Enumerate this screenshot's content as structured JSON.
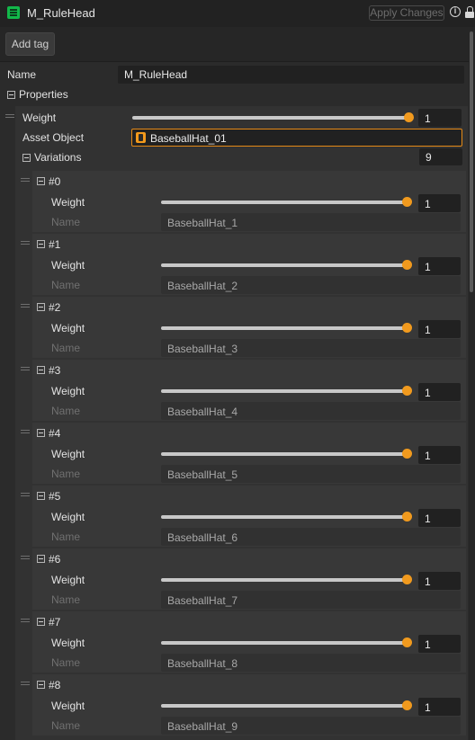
{
  "window": {
    "title": "M_RuleHead",
    "apply_label": "Apply Changes"
  },
  "toolbar": {
    "add_tag_label": "Add tag"
  },
  "name_row": {
    "label": "Name",
    "value": "M_RuleHead"
  },
  "properties": {
    "label": "Properties",
    "weight_label": "Weight",
    "weight_value": "1",
    "weight_fraction": 1.0,
    "asset_label": "Asset Object",
    "asset_value": "BaseballHat_01",
    "variations_label": "Variations",
    "variations_count": "9",
    "variations": [
      {
        "header": "#0",
        "weight_label": "Weight",
        "weight": "1",
        "weight_fraction": 1.0,
        "name_label": "Name",
        "name": "BaseballHat_1"
      },
      {
        "header": "#1",
        "weight_label": "Weight",
        "weight": "1",
        "weight_fraction": 1.0,
        "name_label": "Name",
        "name": "BaseballHat_2"
      },
      {
        "header": "#2",
        "weight_label": "Weight",
        "weight": "1",
        "weight_fraction": 1.0,
        "name_label": "Name",
        "name": "BaseballHat_3"
      },
      {
        "header": "#3",
        "weight_label": "Weight",
        "weight": "1",
        "weight_fraction": 1.0,
        "name_label": "Name",
        "name": "BaseballHat_4"
      },
      {
        "header": "#4",
        "weight_label": "Weight",
        "weight": "1",
        "weight_fraction": 1.0,
        "name_label": "Name",
        "name": "BaseballHat_5"
      },
      {
        "header": "#5",
        "weight_label": "Weight",
        "weight": "1",
        "weight_fraction": 1.0,
        "name_label": "Name",
        "name": "BaseballHat_6"
      },
      {
        "header": "#6",
        "weight_label": "Weight",
        "weight": "1",
        "weight_fraction": 1.0,
        "name_label": "Name",
        "name": "BaseballHat_7"
      },
      {
        "header": "#7",
        "weight_label": "Weight",
        "weight": "1",
        "weight_fraction": 1.0,
        "name_label": "Name",
        "name": "BaseballHat_8"
      },
      {
        "header": "#8",
        "weight_label": "Weight",
        "weight": "1",
        "weight_fraction": 1.0,
        "name_label": "Name",
        "name": "BaseballHat_9"
      }
    ]
  },
  "colors": {
    "accent": "#f19a1e",
    "background": "#2b2b2b",
    "field": "#212121",
    "asset_border": "#e58a16",
    "app_icon": "#12b84a"
  },
  "icons": [
    "app-icon",
    "info-icon",
    "lock-icon",
    "collapse-icon",
    "drag-handle-icon",
    "asset-object-icon"
  ]
}
